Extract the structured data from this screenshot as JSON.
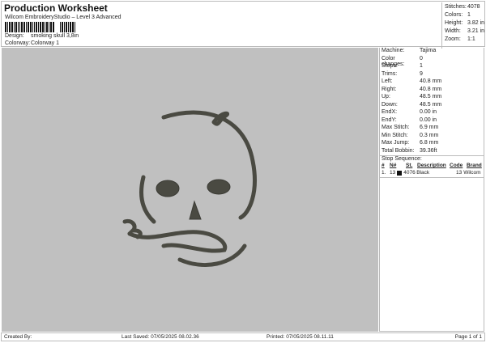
{
  "header": {
    "title": "Production Worksheet",
    "subtitle": "Wilcom EmbroideryStudio – Level 3 Advanced",
    "design_label": "Design:",
    "design_value": "smoking skull 3,8in",
    "colorway_label": "Colorway:",
    "colorway_value": "Colorway 1"
  },
  "stats": [
    {
      "k": "Stitches:",
      "v": "4078"
    },
    {
      "k": "Colors:",
      "v": "1"
    },
    {
      "k": "Height:",
      "v": "3.82 in"
    },
    {
      "k": "Width:",
      "v": "3.21 in"
    },
    {
      "k": "Zoom:",
      "v": "1:1"
    }
  ],
  "panel": [
    {
      "k": "Machine:",
      "v": "Tajima"
    },
    {
      "k": "Color changes:",
      "v": "0"
    },
    {
      "k": "Stops:",
      "v": "1"
    },
    {
      "k": "Trims:",
      "v": "9"
    },
    {
      "k": "Left:",
      "v": "40.8 mm"
    },
    {
      "k": "Right:",
      "v": "40.8 mm"
    },
    {
      "k": "Up:",
      "v": "48.5 mm"
    },
    {
      "k": "Down:",
      "v": "48.5 mm"
    },
    {
      "k": "EndX:",
      "v": "0.00 in"
    },
    {
      "k": "EndY:",
      "v": "0.00 in"
    },
    {
      "k": "Max Stitch:",
      "v": "6.9 mm"
    },
    {
      "k": "Min Stitch:",
      "v": "0.3 mm"
    },
    {
      "k": "Max Jump:",
      "v": "6.8 mm"
    },
    {
      "k": "Total Bobbin:",
      "v": "39.36ft"
    }
  ],
  "stop_sequence": {
    "title": "Stop Sequence:",
    "headers": [
      "#",
      "N#",
      "St.",
      "Description",
      "Code",
      "Brand"
    ],
    "rows": [
      {
        "num": "1.",
        "n": "13",
        "color": "#111111",
        "st": "4076",
        "desc": "Black",
        "code": "13",
        "brand": "Wilcom"
      }
    ]
  },
  "footer": {
    "created": "Created By:",
    "saved": "Last Saved: 07/05/2025 08.02.36",
    "printed": "Printed: 07/05/2025 08.11.11",
    "page": "Page 1 of 1"
  },
  "colors": {
    "thread": "#4a4a42",
    "canvas": "#c0c0c0"
  }
}
